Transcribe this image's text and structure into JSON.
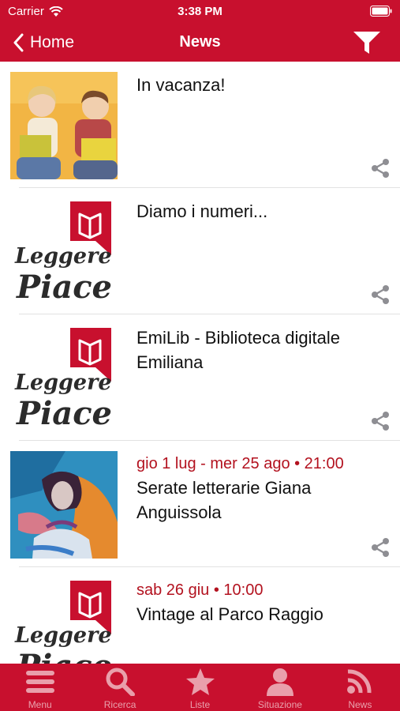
{
  "status_bar": {
    "carrier": "Carrier",
    "time": "3:38 PM"
  },
  "nav": {
    "back_label": "Home",
    "title": "News"
  },
  "news": [
    {
      "title": "In vacanza!",
      "date": "",
      "image": "children-reading-photo"
    },
    {
      "title": "Diamo i numeri...",
      "date": "",
      "image": "leggere-piace-logo"
    },
    {
      "title": "EmiLib - Biblioteca digitale Emiliana",
      "date": "",
      "image": "leggere-piace-logo"
    },
    {
      "title": "Serate letterarie Giana Anguissola",
      "date": "gio 1 lug - mer 25 ago • 21:00",
      "image": "portrait-artwork"
    },
    {
      "title": "Vintage al Parco Raggio",
      "date": "sab 26 giu • 10:00",
      "image": "leggere-piace-logo"
    }
  ],
  "logo": {
    "line1": "Leggere",
    "line2": "Piace"
  },
  "tabs": [
    {
      "label": "Menu",
      "icon": "menu-icon"
    },
    {
      "label": "Ricerca",
      "icon": "search-icon"
    },
    {
      "label": "Liste",
      "icon": "star-icon"
    },
    {
      "label": "Situazione",
      "icon": "user-icon"
    },
    {
      "label": "News",
      "icon": "rss-icon"
    }
  ],
  "colors": {
    "brand": "#c8102e",
    "date_text": "#b3121f"
  }
}
